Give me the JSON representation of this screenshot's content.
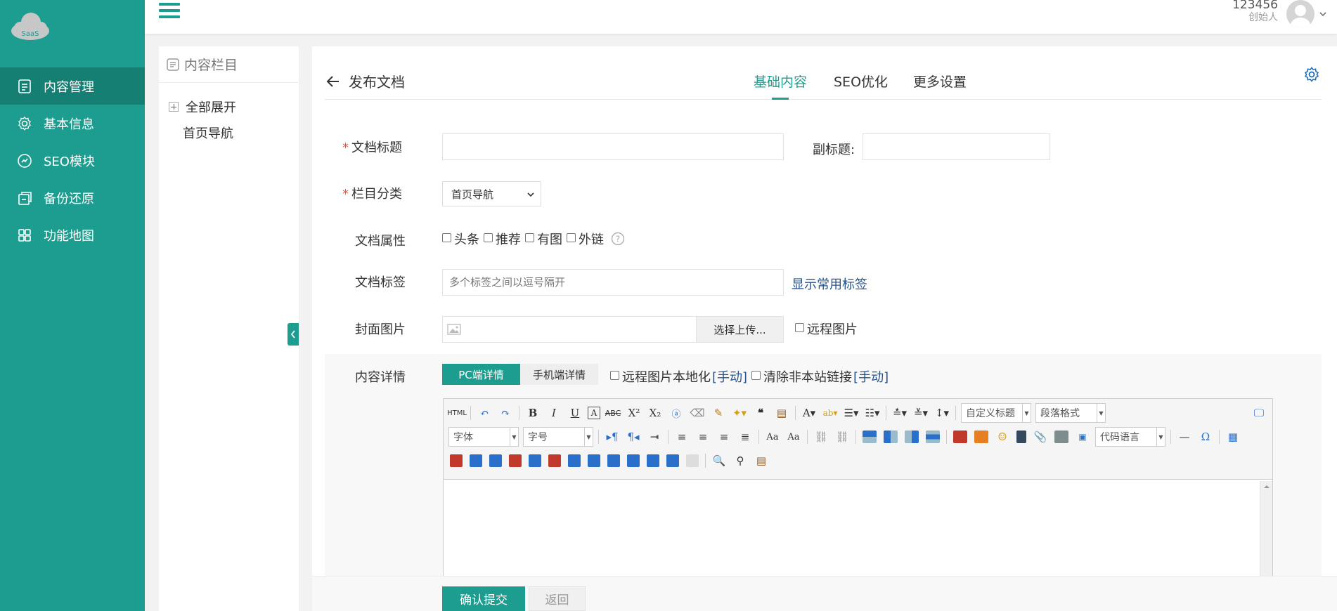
{
  "sidebar": {
    "logo_text": "SaaS",
    "items": [
      {
        "label": "内容管理",
        "icon": "document-icon",
        "active": true
      },
      {
        "label": "基本信息",
        "icon": "gear-icon",
        "active": false
      },
      {
        "label": "SEO模块",
        "icon": "seo-icon",
        "active": false
      },
      {
        "label": "备份还原",
        "icon": "backup-icon",
        "active": false
      },
      {
        "label": "功能地图",
        "icon": "grid-icon",
        "active": false
      }
    ]
  },
  "header": {
    "user_name": "123456",
    "user_role": "创始人"
  },
  "column_panel": {
    "title": "内容栏目",
    "expand_all": "全部展开",
    "items": [
      "首页导航"
    ]
  },
  "page": {
    "back_label": "发布文档",
    "tabs": [
      "基础内容",
      "SEO优化",
      "更多设置"
    ],
    "active_tab": 0
  },
  "form": {
    "title_label": "文档标题",
    "subtitle_label": "副标题:",
    "category_label": "栏目分类",
    "category_value": "首页导航",
    "attrs_label": "文档属性",
    "attrs": [
      "头条",
      "推荐",
      "有图",
      "外链"
    ],
    "tags_label": "文档标签",
    "tags_placeholder": "多个标签之间以逗号隔开",
    "tags_link": "显示常用标签",
    "cover_label": "封面图片",
    "upload_button": "选择上传...",
    "remote_image": "远程图片",
    "detail_label": "内容详情",
    "pc_tab": "PC端详情",
    "mobile_tab": "手机端详情",
    "localize_remote": "远程图片本地化",
    "manual_1": "[手动]",
    "clear_links": "清除非本站链接",
    "manual_2": "[手动]"
  },
  "editor": {
    "html_label": "HTML",
    "custom_title": "自定义标题",
    "paragraph_format": "段落格式",
    "font_family": "字体",
    "font_size": "字号",
    "code_lang": "代码语言"
  },
  "actions": {
    "submit": "确认提交",
    "back": "返回"
  },
  "colors": {
    "primary": "#1d9d8f",
    "primary_dark": "#167f74",
    "required": "#e8563c",
    "link": "#27538d"
  }
}
